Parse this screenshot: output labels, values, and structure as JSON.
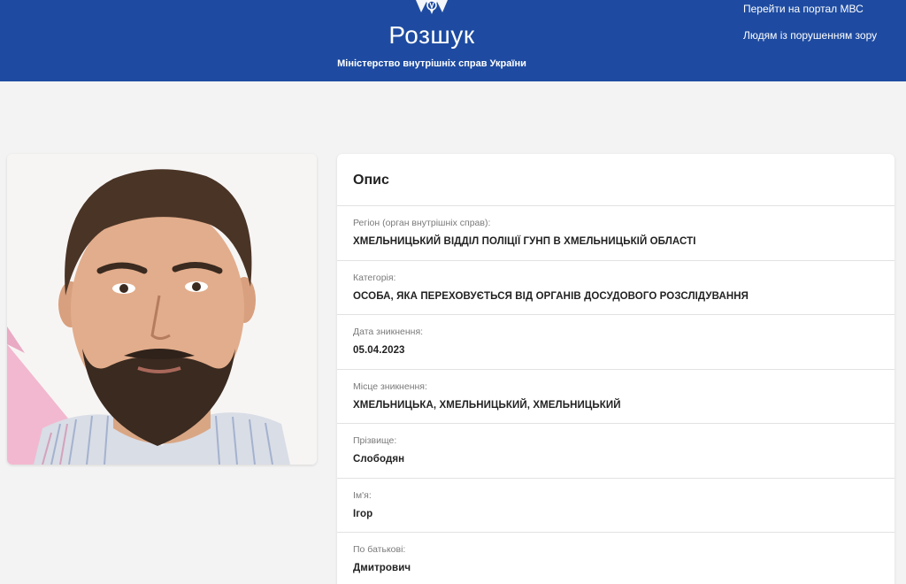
{
  "header": {
    "title": "Розшук",
    "subtitle": "Міністерство внутрішніх справ України",
    "links": [
      {
        "label": "Перейти на портал МВС"
      },
      {
        "label": "Людям із порушенням зору"
      }
    ]
  },
  "colors": {
    "header_bg": "#1e4ba1",
    "page_bg": "#f3f3f3",
    "card_bg": "#ffffff"
  },
  "card": {
    "title": "Опис",
    "fields": [
      {
        "label": "Регіон (орган внутрішніх справ):",
        "value": "ХМЕЛЬНИЦЬКИЙ ВІДДІЛ ПОЛІЦІЇ ГУНП В ХМЕЛЬНИЦЬКІЙ ОБЛАСТІ"
      },
      {
        "label": "Категорія:",
        "value": "ОСОБА, ЯКА ПЕРЕХОВУЄТЬСЯ ВІД ОРГАНІВ ДОСУДОВОГО РОЗСЛІДУВАННЯ"
      },
      {
        "label": "Дата зникнення:",
        "value": "05.04.2023"
      },
      {
        "label": "Місце зникнення:",
        "value": "ХМЕЛЬНИЦЬКА, ХМЕЛЬНИЦЬКИЙ, ХМЕЛЬНИЦЬКИЙ"
      },
      {
        "label": "Прізвище:",
        "value": "Слободян"
      },
      {
        "label": "Ім'я:",
        "value": "Ігор"
      },
      {
        "label": "По батькові:",
        "value": "Дмитрович"
      }
    ]
  },
  "photo": {
    "icon": "person-photo"
  }
}
